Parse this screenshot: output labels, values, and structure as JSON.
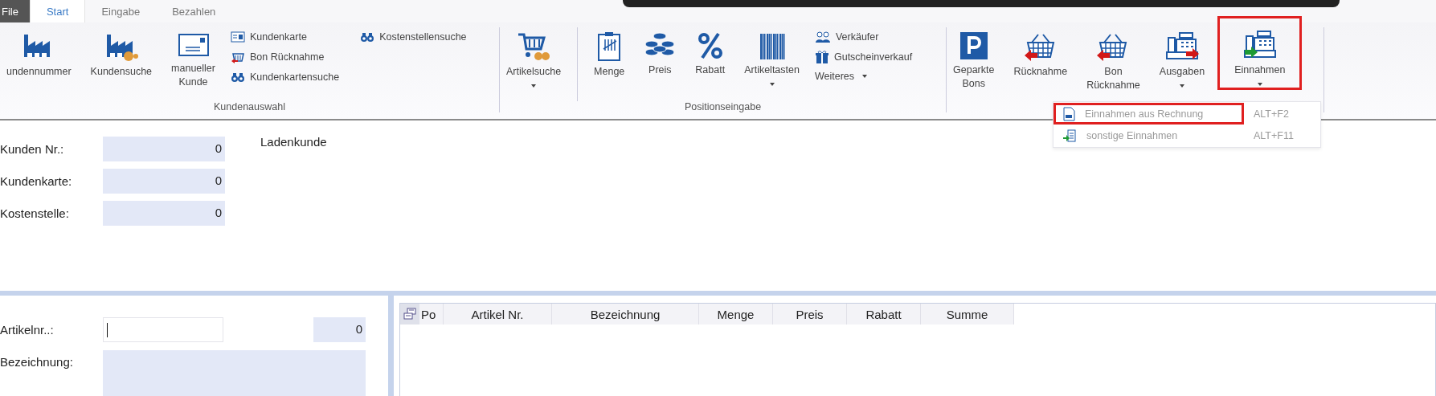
{
  "menu_tabs": [
    {
      "label": "File",
      "kind": "file",
      "selected": false
    },
    {
      "label": "Start",
      "kind": "tab",
      "selected": true
    },
    {
      "label": "Eingabe",
      "kind": "tab",
      "selected": false
    },
    {
      "label": "Bezahlen",
      "kind": "tab",
      "selected": false
    }
  ],
  "ribbon": {
    "groups": [
      {
        "label": "Kundenauswahl",
        "items": [
          {
            "kind": "large",
            "label": "undennummer",
            "dropdown": false,
            "highlighted": false
          },
          {
            "kind": "large",
            "label": "Kundensuche",
            "dropdown": false,
            "highlighted": false
          },
          {
            "kind": "large",
            "label": "manueller\nKunde",
            "dropdown": false,
            "highlighted": false
          },
          {
            "kind": "column",
            "items": [
              {
                "label": "Kundenkarte",
                "dropdown": false
              },
              {
                "label": "Bon Rücknahme",
                "dropdown": false
              },
              {
                "label": "Kundenkartensuche",
                "dropdown": false
              }
            ]
          },
          {
            "kind": "column",
            "items": [
              {
                "label": "Kostenstellensuche",
                "dropdown": false
              }
            ]
          }
        ]
      },
      {
        "label": "Positionseingabe",
        "items": [
          {
            "kind": "large",
            "label": "Artikelsuche",
            "dropdown": true,
            "highlighted": false
          },
          {
            "kind": "separator"
          },
          {
            "kind": "large",
            "label": "Menge",
            "dropdown": false,
            "highlighted": false
          },
          {
            "kind": "large",
            "label": "Preis",
            "dropdown": false,
            "highlighted": false
          },
          {
            "kind": "large",
            "label": "Rabatt",
            "dropdown": false,
            "highlighted": false
          },
          {
            "kind": "large",
            "label": "Artikeltasten",
            "dropdown": true,
            "highlighted": false
          },
          {
            "kind": "column",
            "items": [
              {
                "label": "Verkäufer",
                "dropdown": false
              },
              {
                "label": "Gutscheinverkauf",
                "dropdown": false
              },
              {
                "label": "Weiteres",
                "dropdown": true
              }
            ]
          }
        ]
      },
      {
        "items": [
          {
            "kind": "large",
            "label": "Geparkte\nBons",
            "dropdown": false,
            "highlighted": false
          },
          {
            "kind": "large",
            "label": "Rücknahme",
            "dropdown": false,
            "highlighted": false
          },
          {
            "kind": "large",
            "label": "Bon\nRücknahme",
            "dropdown": false,
            "highlighted": false
          },
          {
            "kind": "large",
            "label": "Ausgaben",
            "dropdown": true,
            "highlighted": false
          },
          {
            "kind": "large",
            "label": "Einnahmen",
            "dropdown": true,
            "highlighted": true
          }
        ]
      }
    ]
  },
  "dropdown_menu": {
    "items": [
      {
        "label": "Einnahmen aus Rechnung",
        "shortcut": "ALT+F2",
        "highlighted": true
      },
      {
        "label": "sonstige Einnahmen",
        "shortcut": "ALT+F11",
        "highlighted": false
      }
    ]
  },
  "customer": {
    "fields": [
      {
        "label": "Kunden Nr.:",
        "value": "0"
      },
      {
        "label": "Kundenkarte:",
        "value": "0"
      },
      {
        "label": "Kostenstelle:",
        "value": "0"
      }
    ],
    "name": "Ladenkunde"
  },
  "article": {
    "number_label": "Artikelnr..:",
    "number_focused": true,
    "count": "0",
    "description_label": "Bezeichnung:"
  },
  "grid": {
    "columns": [
      "Po",
      "Artikel Nr.",
      "Bezeichnung",
      "Menge",
      "Preis",
      "Rabatt",
      "Summe"
    ]
  }
}
